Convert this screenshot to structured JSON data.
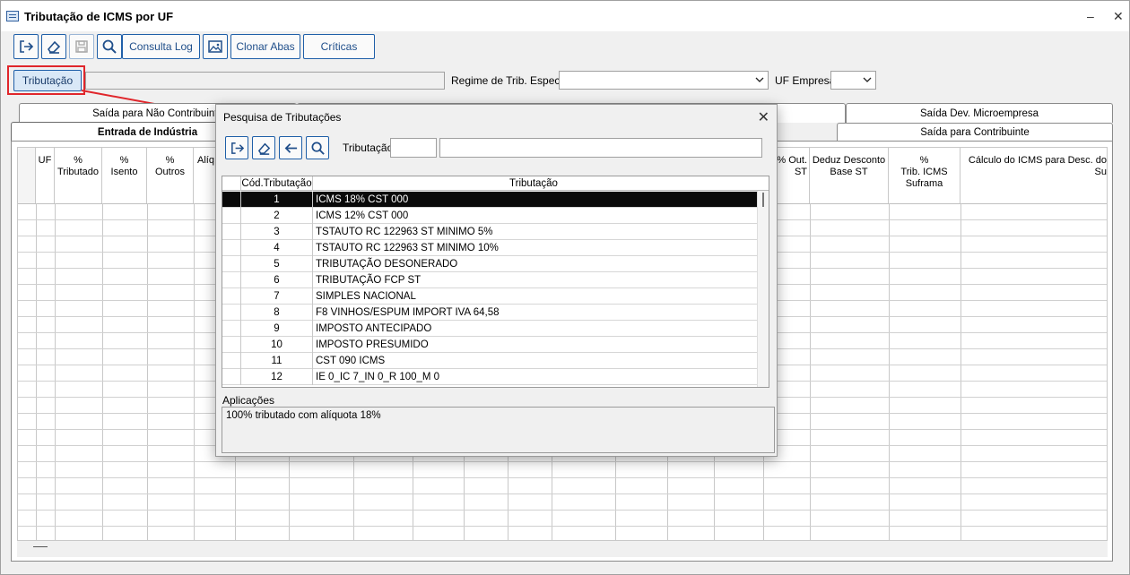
{
  "window": {
    "title": "Tributação de ICMS por UF",
    "minimize": "–",
    "close": "✕"
  },
  "toolbar": {
    "consulta_log": "Consulta Log",
    "clonar_abas": "Clonar Abas",
    "criticas": "Críticas"
  },
  "filters": {
    "tributacao_button": "Tributação",
    "regime_label": "Regime de Trib. Especial",
    "uf_empresa_label": "UF Empresa"
  },
  "tabs": {
    "row1": [
      "Saída para Não Contribuinte",
      "Saída Dev. Microempresa"
    ],
    "row2": [
      "Entrada de Indústria",
      "Saída para Contribuinte"
    ]
  },
  "grid": {
    "headers": [
      "UF",
      "% Tributado",
      "% Isento",
      "% Outros",
      "Alíq",
      "% Out. ST",
      "Deduz Desconto Base ST",
      "% Trib. ICMS Suframa",
      "Cálculo do ICMS para Desc. do Su"
    ]
  },
  "dialog": {
    "title": "Pesquisa de Tributações",
    "close": "✕",
    "search_label": "Tributação",
    "columns": [
      "Cód.Tributação",
      "Tributação"
    ],
    "rows": [
      {
        "code": "1",
        "name": "ICMS 18% CST 000"
      },
      {
        "code": "2",
        "name": "ICMS 12% CST 000"
      },
      {
        "code": "3",
        "name": "TSTAUTO RC 122963 ST MINIMO 5%"
      },
      {
        "code": "4",
        "name": "TSTAUTO RC 122963 ST MINIMO 10%"
      },
      {
        "code": "5",
        "name": "TRIBUTAÇÃO DESONERADO"
      },
      {
        "code": "6",
        "name": "TRIBUTAÇÃO FCP ST"
      },
      {
        "code": "7",
        "name": "SIMPLES NACIONAL"
      },
      {
        "code": "8",
        "name": "F8 VINHOS/ESPUM IMPORT IVA 64,58"
      },
      {
        "code": "9",
        "name": "IMPOSTO ANTECIPADO"
      },
      {
        "code": "10",
        "name": "IMPOSTO PRESUMIDO"
      },
      {
        "code": "11",
        "name": "CST 090 ICMS"
      },
      {
        "code": "12",
        "name": "IE 0_IC 7_IN 0_R 100_M 0"
      }
    ],
    "aplicacoes_label": "Aplicações",
    "aplicacoes_text": "100% tributado com alíquota 18%"
  },
  "colors": {
    "accent": "#1f5fa8",
    "highlight": "#e0262b",
    "selected_row": "#0a0a0a"
  }
}
